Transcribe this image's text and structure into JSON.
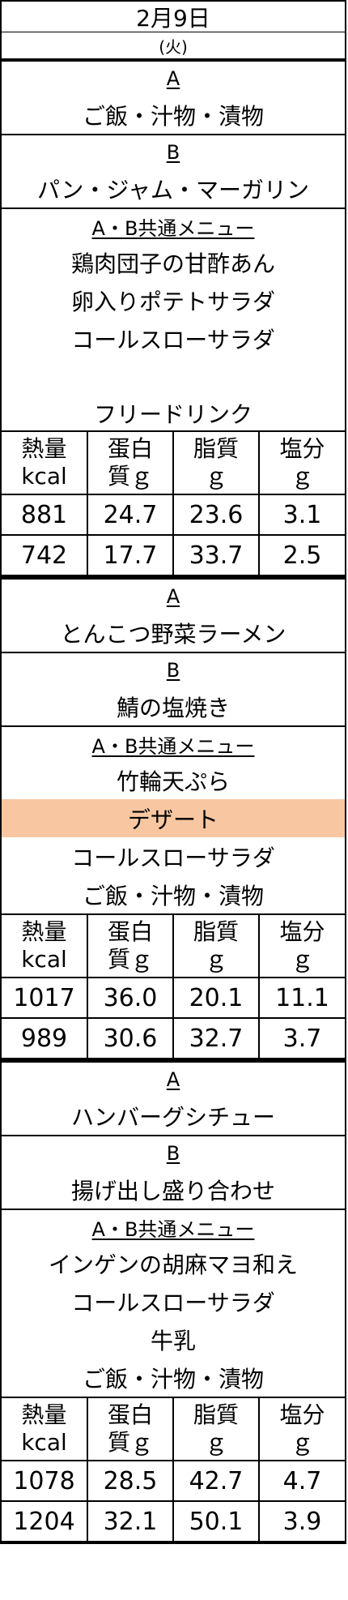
{
  "header": {
    "date": "2月9日",
    "day": "(火)"
  },
  "nutrition_headers": [
    {
      "line1": "熱量",
      "line2": "kcal"
    },
    {
      "line1": "蛋白",
      "line2": "質ｇ"
    },
    {
      "line1": "脂質",
      "line2": "ｇ"
    },
    {
      "line1": "塩分",
      "line2": "ｇ"
    }
  ],
  "meals": [
    {
      "a_label": "A",
      "a_items": [
        "ご飯・汁物・漬物"
      ],
      "b_label": "B",
      "b_items": [
        "パン・ジャム・マーガリン"
      ],
      "common_label": "A・B共通メニュー",
      "common_items": [
        "鶏肉団子の甘酢あん",
        "卵入りポテトサラダ",
        "コールスローサラダ",
        "",
        "フリードリンク"
      ],
      "nutrition": [
        [
          "881",
          "24.7",
          "23.6",
          "3.1"
        ],
        [
          "742",
          "17.7",
          "33.7",
          "2.5"
        ]
      ]
    },
    {
      "a_label": "A",
      "a_items": [
        "とんこつ野菜ラーメン"
      ],
      "b_label": "B",
      "b_items": [
        "鯖の塩焼き"
      ],
      "common_label": "A・B共通メニュー",
      "common_items": [
        "竹輪天ぷら",
        "デザート",
        "コールスローサラダ",
        "ご飯・汁物・漬物"
      ],
      "nutrition": [
        [
          "1017",
          "36.0",
          "20.1",
          "11.1"
        ],
        [
          "989",
          "30.6",
          "32.7",
          "3.7"
        ]
      ]
    },
    {
      "a_label": "A",
      "a_items": [
        "ハンバーグシチュー"
      ],
      "b_label": "B",
      "b_items": [
        "揚げ出し盛り合わせ"
      ],
      "common_label": "A・B共通メニュー",
      "common_items": [
        "インゲンの胡麻マヨ和え",
        "コールスローサラダ",
        "牛乳",
        "ご飯・汁物・漬物"
      ],
      "nutrition": [
        [
          "1078",
          "28.5",
          "42.7",
          "4.7"
        ],
        [
          "1204",
          "32.1",
          "50.1",
          "3.9"
        ]
      ]
    }
  ],
  "highlight_color": "#f8c7a2"
}
